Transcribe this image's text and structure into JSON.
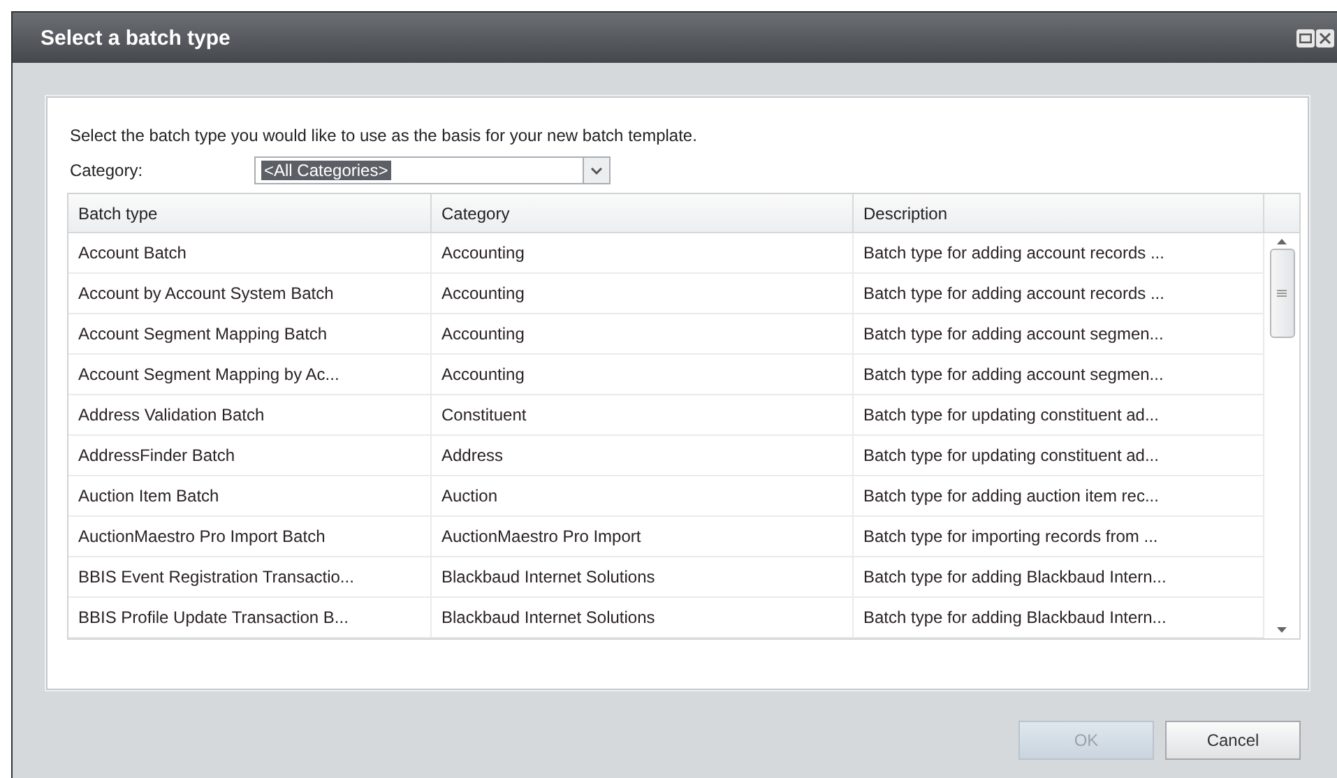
{
  "window": {
    "title": "Select a batch type"
  },
  "instructions": "Select the batch type you would like to use as the basis for your new batch template.",
  "category_filter": {
    "label": "Category:",
    "value": "<All Categories>"
  },
  "table": {
    "columns": [
      "Batch type",
      "Category",
      "Description"
    ],
    "rows": [
      [
        "Account Batch",
        "Accounting",
        "Batch type for adding account records ..."
      ],
      [
        "Account by Account System Batch",
        "Accounting",
        "Batch type for adding account records ..."
      ],
      [
        "Account Segment Mapping Batch",
        "Accounting",
        "Batch type for adding account segmen..."
      ],
      [
        "Account Segment Mapping by Ac...",
        "Accounting",
        "Batch type for adding account segmen..."
      ],
      [
        "Address Validation Batch",
        "Constituent",
        "Batch type for updating constituent ad..."
      ],
      [
        "AddressFinder Batch",
        "Address",
        "Batch type for updating constituent ad..."
      ],
      [
        "Auction Item Batch",
        "Auction",
        "Batch type for adding auction item rec..."
      ],
      [
        "AuctionMaestro Pro Import Batch",
        "AuctionMaestro Pro Import",
        "Batch type for importing records from ..."
      ],
      [
        "BBIS Event Registration Transactio...",
        "Blackbaud Internet Solutions",
        "Batch type for adding Blackbaud Intern..."
      ],
      [
        "BBIS Profile Update Transaction B...",
        "Blackbaud Internet Solutions",
        "Batch type for adding Blackbaud Intern..."
      ]
    ]
  },
  "buttons": [
    {
      "label": "OK",
      "disabled": true
    },
    {
      "label": "Cancel",
      "disabled": false
    }
  ]
}
